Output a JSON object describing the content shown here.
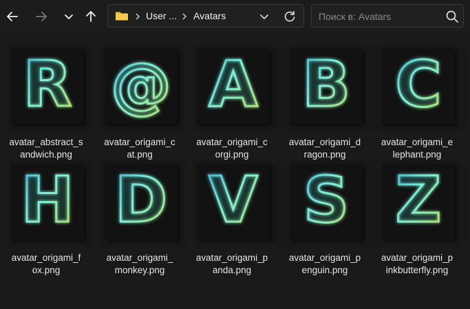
{
  "window": {
    "address": {
      "segments": [
        "User ...",
        "Avatars"
      ]
    },
    "search": {
      "placeholder": "Поиск в: Avatars"
    }
  },
  "colors": {
    "accent_glow": "#5fe0c0",
    "folder": "#e8b93a"
  },
  "files": [
    {
      "glyph": "R",
      "name_line1": "avatar_abstract_s",
      "name_line2": "andwich.png"
    },
    {
      "glyph": "@",
      "name_line1": "avatar_origami_c",
      "name_line2": "at.png"
    },
    {
      "glyph": "A",
      "name_line1": "avatar_origami_c",
      "name_line2": "orgi.png"
    },
    {
      "glyph": "B",
      "name_line1": "avatar_origami_d",
      "name_line2": "ragon.png"
    },
    {
      "glyph": "C",
      "name_line1": "avatar_origami_e",
      "name_line2": "lephant.png"
    },
    {
      "glyph": "H",
      "name_line1": "avatar_origami_f",
      "name_line2": "ox.png"
    },
    {
      "glyph": "D",
      "name_line1": "avatar_origami_",
      "name_line2": "monkey.png"
    },
    {
      "glyph": "V",
      "name_line1": "avatar_origami_p",
      "name_line2": "anda.png"
    },
    {
      "glyph": "S",
      "name_line1": "avatar_origami_p",
      "name_line2": "enguin.png"
    },
    {
      "glyph": "Z",
      "name_line1": "avatar_origami_p",
      "name_line2": "inkbutterfly.png"
    }
  ]
}
